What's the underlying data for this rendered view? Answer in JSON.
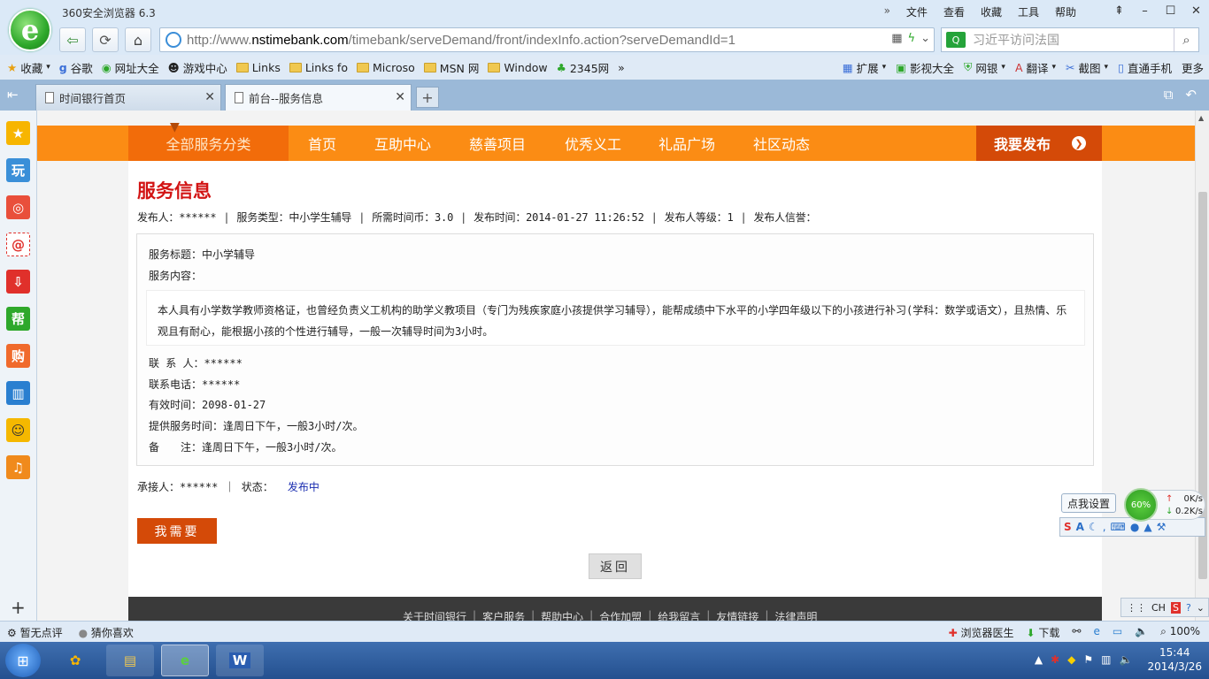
{
  "browser": {
    "app_title": "360安全浏览器 6.3",
    "menu": [
      "文件",
      "查看",
      "收藏",
      "工具",
      "帮助"
    ],
    "url_prefix": "http://www.",
    "url_domain": "nstimebank.com",
    "url_path": "/timebank/serveDemand/front/indexInfo.action?serveDemandId=1",
    "search_placeholder": "习近平访问法国",
    "bookmarks": [
      "收藏",
      "谷歌",
      "网址大全",
      "游戏中心",
      "Links",
      "Links fo",
      "Microso",
      "MSN 网",
      "Window",
      "2345网"
    ],
    "bookmarks_right": [
      "扩展",
      "影视大全",
      "网银",
      "翻译",
      "截图",
      "直通手机",
      "更多"
    ],
    "tabs": [
      {
        "label": "时间银行首页"
      },
      {
        "label": "前台--服务信息"
      }
    ]
  },
  "sidebar_icons": [
    "star-icon",
    "play-icon",
    "weibo-icon",
    "mail-icon",
    "download-icon",
    "help-icon",
    "shop-icon",
    "book-icon",
    "face-icon",
    "music-icon"
  ],
  "sidebar_labels": {
    "play": "玩",
    "help": "帮",
    "shop": "购"
  },
  "site_nav": {
    "all_categories": "全部服务分类",
    "items": [
      "首页",
      "互助中心",
      "慈善项目",
      "优秀义工",
      "礼品广场",
      "社区动态"
    ],
    "publish": "我要发布"
  },
  "page": {
    "title": "服务信息",
    "meta": {
      "publisher": "发布人：******",
      "type": "服务类型：中小学生辅导",
      "coins": "所需时间币：3.0",
      "time": "发布时间：2014-01-27 11:26:52",
      "level": "发布人等级：1",
      "credit": "发布人信誉："
    },
    "service_title": "服务标题：中小学辅导",
    "service_content_label": "服务内容：",
    "service_content": "本人具有小学数学教师资格证，也曾经负责义工机构的助学义教项目（专门为残疾家庭小孩提供学习辅导），能帮成绩中下水平的小学四年级以下的小孩进行补习(学科：数学或语文），且热情、乐观且有耐心，能根据小孩的个性进行辅导，一般一次辅导时间为3小时。",
    "contact": "联 系 人：******",
    "phone": "联系电话：******",
    "valid": "有效时间：2098-01-27",
    "serve_time": "提供服务时间：逢周日下午，一般3小时/次。",
    "note": "备　　注：逢周日下午，一般3小时/次。",
    "taker": "承接人：****** ｜ 状态：",
    "status": "发布中",
    "need_button": "我需要",
    "back_button": "返回"
  },
  "footer_links": [
    "关于时间银行",
    "客户服务",
    "帮助中心",
    "合作加盟",
    "给我留言",
    "友情链接",
    "法律声明"
  ],
  "widgets": {
    "ime_settings": "点我设置",
    "net_percent": "60%",
    "net_up": "0K/s",
    "net_down": "0.2K/s",
    "ime_corner": "CH"
  },
  "statusbar": {
    "left": [
      "暂无点评",
      "猜你喜欢"
    ],
    "right": [
      "浏览器医生",
      "下载"
    ],
    "zoom": "100%"
  },
  "taskbar": {
    "time": "15:44",
    "date": "2014/3/26"
  },
  "colors": {
    "nav_orange": "#fb8c14",
    "accent_red": "#d44a08",
    "title_red": "#d21414",
    "status_blue": "#1a2db0"
  }
}
